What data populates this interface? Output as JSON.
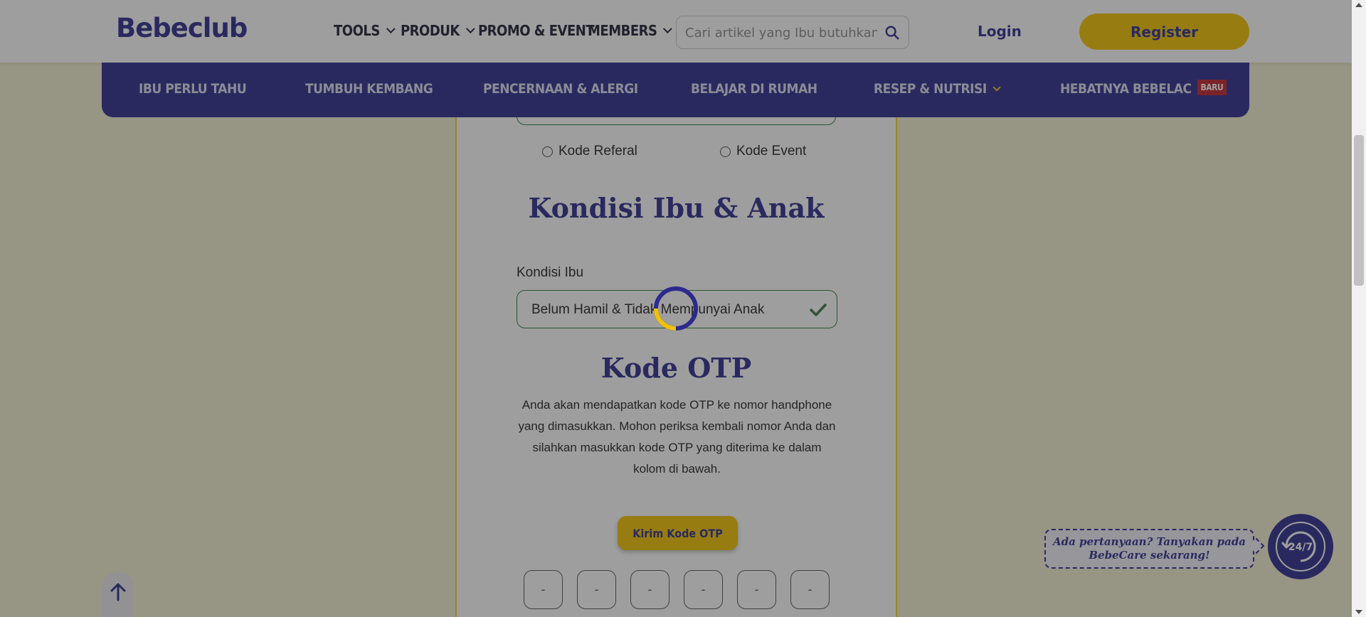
{
  "header": {
    "logo": "Bebeclub",
    "nav": [
      {
        "label": "TOOLS",
        "has_dropdown": true
      },
      {
        "label": "PRODUK",
        "has_dropdown": true
      },
      {
        "label": "PROMO & EVENT",
        "has_dropdown": false
      },
      {
        "label": "MEMBERS",
        "has_dropdown": true
      }
    ],
    "search_placeholder": "Cari artikel yang Ibu butuhkan",
    "login": "Login",
    "register": "Register"
  },
  "categories": [
    {
      "label": "IBU PERLU TAHU"
    },
    {
      "label": "TUMBUH KEMBANG"
    },
    {
      "label": "PENCERNAAN & ALERGI"
    },
    {
      "label": "BELAJAR DI RUMAH"
    },
    {
      "label": "RESEP & NUTRISI",
      "has_dropdown": true
    },
    {
      "label": "HEBATNYA BEBELAC",
      "badge": "BARU"
    }
  ],
  "form": {
    "code_options": [
      "Kode Referal",
      "Kode Event"
    ],
    "condition_title": "Kondisi Ibu & Anak",
    "mother_condition_label": "Kondisi Ibu",
    "mother_condition_value": "Belum Hamil & Tidak Mempunyai Anak",
    "otp_title": "Kode OTP",
    "otp_description": "Anda akan mendapatkan kode OTP ke nomor handphone yang dimasukkan. Mohon periksa kembali nomor Anda dan silahkan masukkan kode OTP yang diterima ke dalam kolom di bawah.",
    "otp_button": "Kirim Kode OTP",
    "otp_placeholders": [
      "-",
      "-",
      "-",
      "-",
      "-",
      "-"
    ]
  },
  "chat": {
    "line1": "Ada pertanyaan? Tanyakan pada",
    "line2": "BebeCare sekarang!",
    "icon_text": "24/7"
  },
  "colors": {
    "brand": "#2d2a8c",
    "accent": "#f2c200",
    "success": "#2d7a3e"
  }
}
